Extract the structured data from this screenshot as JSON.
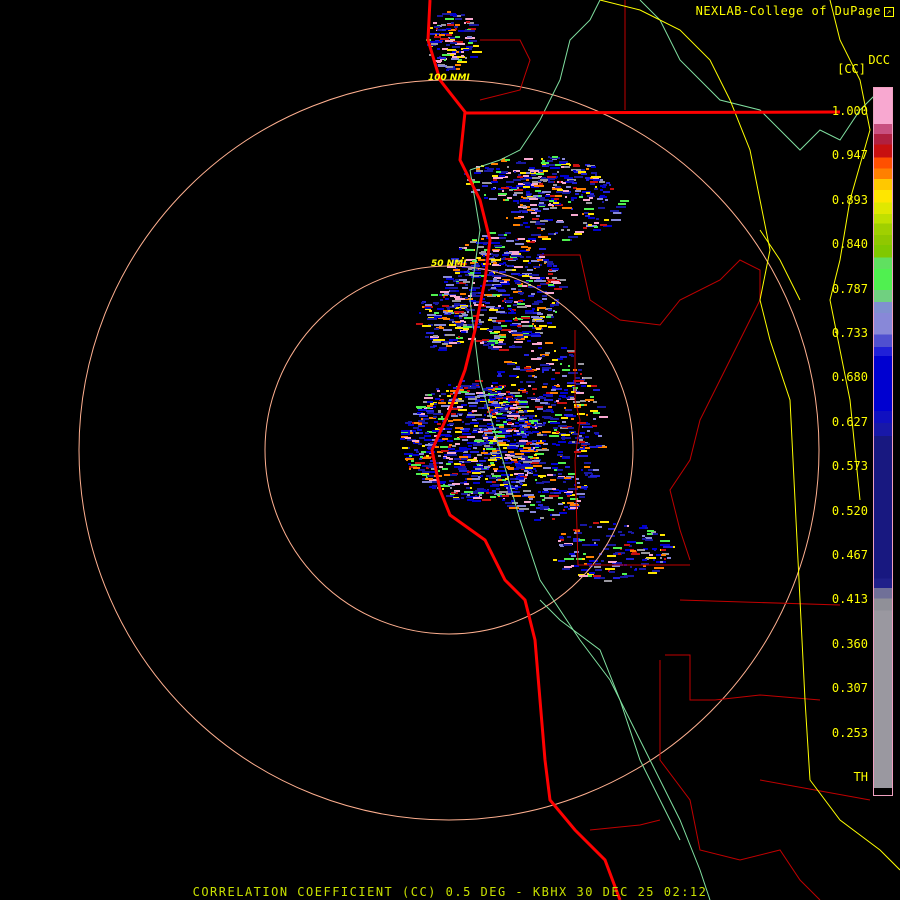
{
  "header": {
    "credit": "NEXLAB-College of DuPage",
    "credit_icon": "external-link-icon",
    "product_code": "DCC",
    "variable_code": "[CC]"
  },
  "map": {
    "ring_labels": [
      "100 NMI",
      "50 NMI"
    ],
    "colors": {
      "coast": "#ff0000",
      "county": "#c00000",
      "state": "#ffff00",
      "river": "#80e0a0",
      "ring": "#ffb090"
    }
  },
  "legend": {
    "ticks": [
      "1.000",
      "0.947",
      "0.893",
      "0.840",
      "0.787",
      "0.733",
      "0.680",
      "0.627",
      "0.573",
      "0.520",
      "0.467",
      "0.413",
      "0.360",
      "0.307",
      "0.253",
      "TH"
    ]
  },
  "footer": {
    "title": "CORRELATION COEFFICIENT (CC) 0.5 DEG - KBHX 30 DEC 25 02:12"
  }
}
